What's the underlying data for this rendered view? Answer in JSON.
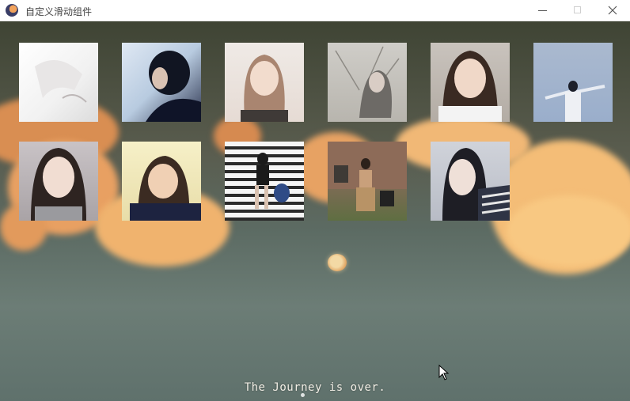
{
  "window": {
    "title": "自定义滑动组件",
    "icon": "app-logo-icon"
  },
  "gallery": {
    "rows": [
      [
        "photo-1",
        "photo-2",
        "photo-3",
        "photo-4",
        "photo-5",
        "photo-6"
      ],
      [
        "photo-7",
        "photo-8",
        "photo-9",
        "photo-10",
        "photo-11"
      ]
    ]
  },
  "caption": "The Journey is over.",
  "colors": {
    "sky_dark": "#3f4434",
    "sky_teal": "#5f716c",
    "cloud_orange": "#e9a25e",
    "caption_text": "#f2efe6"
  }
}
